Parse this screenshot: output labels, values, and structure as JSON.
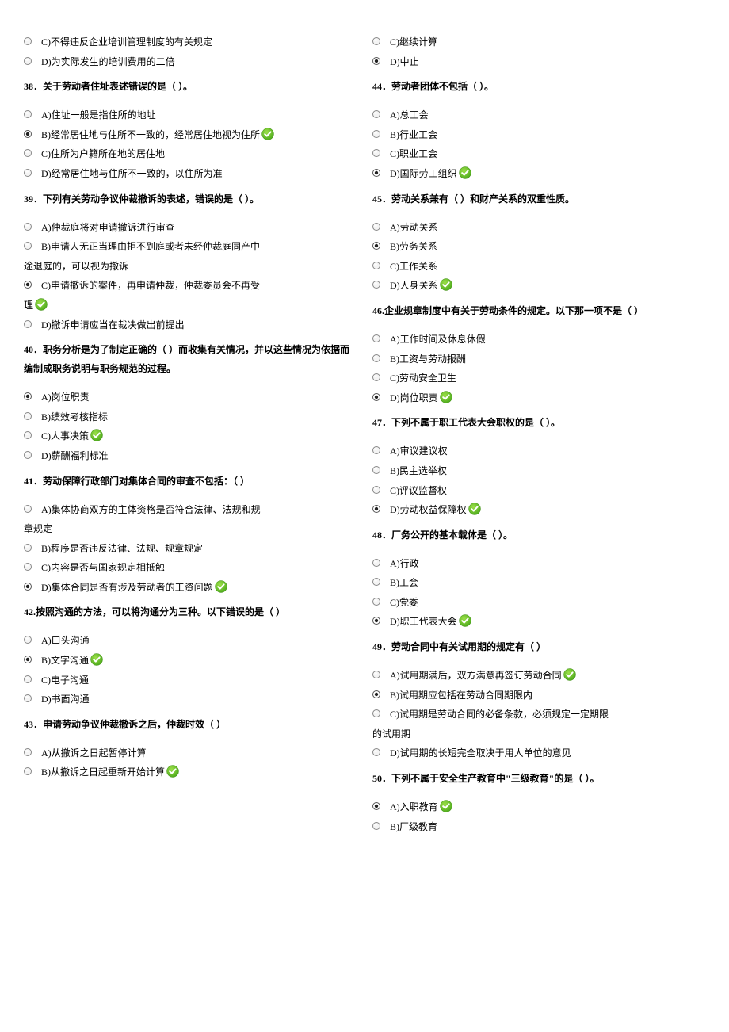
{
  "left": {
    "pre_options": [
      {
        "l": "C)",
        "t": "不得违反企业培训管理制度的有关规定",
        "sel": false,
        "ok": false
      },
      {
        "l": "D)",
        "t": "为实际发生的培训费用的二倍",
        "sel": false,
        "ok": false
      }
    ],
    "q38": {
      "title": "38．关于劳动者住址表述错误的是（  ）。",
      "opts": [
        {
          "l": "A)",
          "t": "住址一般是指住所的地址",
          "sel": false,
          "ok": false
        },
        {
          "l": "B)",
          "t": "经常居住地与住所不一致的，经常居住地视为住所",
          "sel": true,
          "ok": true
        },
        {
          "l": "C)",
          "t": "住所为户籍所在地的居住地",
          "sel": false,
          "ok": false
        },
        {
          "l": "D)",
          "t": "经常居住地与住所不一致的，以住所为准",
          "sel": false,
          "ok": false
        }
      ]
    },
    "q39": {
      "title": "39．下列有关劳动争议仲裁撤诉的表述，错误的是（  ）。",
      "opts": [
        {
          "l": "A)",
          "t": "仲裁庭将对申请撤诉进行审查",
          "sel": false,
          "ok": false
        },
        {
          "l": "B)",
          "t": "申请人无正当理由拒不到庭或者未经仲裁庭同产中",
          "cont": "途退庭的，可以视为撤诉",
          "sel": false,
          "ok": false
        },
        {
          "l": "C)",
          "t": "申请撤诉的案件，再申请仲裁，仲裁委员会不再受",
          "cont": "理",
          "sel": true,
          "ok": true
        },
        {
          "l": "D)",
          "t": "撤诉申请应当在裁决做出前提出",
          "sel": false,
          "ok": false
        }
      ]
    },
    "q40": {
      "title": "40．职务分析是为了制定正确的（  ）而收集有关情况，并以这些情况为依据而编制成职务说明与职务规范的过程。",
      "opts": [
        {
          "l": "A)",
          "t": "岗位职责",
          "sel": true,
          "ok": false
        },
        {
          "l": "B)",
          "t": "绩效考核指标",
          "sel": false,
          "ok": false
        },
        {
          "l": "C)",
          "t": "人事决策",
          "sel": false,
          "ok": true
        },
        {
          "l": "D)",
          "t": "薪酬福利标准",
          "sel": false,
          "ok": false
        }
      ]
    },
    "q41": {
      "title": "41．劳动保障行政部门对集体合同的审查不包括：（  ）",
      "opts": [
        {
          "l": "A)",
          "t": "集体协商双方的主体资格是否符合法律、法规和规",
          "cont": "章规定",
          "sel": false,
          "ok": false
        },
        {
          "l": "B)",
          "t": "程序是否违反法律、法规、规章规定",
          "sel": false,
          "ok": false
        },
        {
          "l": "C)",
          "t": "内容是否与国家规定相抵触",
          "sel": false,
          "ok": false
        },
        {
          "l": "D)",
          "t": "集体合同是否有涉及劳动者的工资问题",
          "sel": true,
          "ok": true
        }
      ]
    },
    "q42": {
      "title": "42.按照沟通的方法，可以将沟通分为三种。以下错误的是（ ）",
      "opts": [
        {
          "l": "A)",
          "t": "口头沟通",
          "sel": false,
          "ok": false
        },
        {
          "l": "B)",
          "t": "文字沟通",
          "sel": true,
          "ok": true
        },
        {
          "l": "C)",
          "t": "电子沟通",
          "sel": false,
          "ok": false
        },
        {
          "l": "D)",
          "t": "书面沟通",
          "sel": false,
          "ok": false
        }
      ]
    },
    "q43": {
      "title": "43．申请劳动争议仲裁撤诉之后，仲裁时效（  ）",
      "opts": [
        {
          "l": "A)",
          "t": "从撤诉之日起暂停计算",
          "sel": false,
          "ok": false
        },
        {
          "l": "B)",
          "t": "从撤诉之日起重新开始计算",
          "sel": false,
          "ok": true
        }
      ]
    }
  },
  "right": {
    "pre_options": [
      {
        "l": "C)",
        "t": "继续计算",
        "sel": false,
        "ok": false
      },
      {
        "l": "D)",
        "t": "中止",
        "sel": true,
        "ok": false
      }
    ],
    "q44": {
      "title": "44．劳动者团体不包括（  ）。",
      "opts": [
        {
          "l": "A)",
          "t": "总工会",
          "sel": false,
          "ok": false
        },
        {
          "l": "B)",
          "t": "行业工会",
          "sel": false,
          "ok": false
        },
        {
          "l": "C)",
          "t": "职业工会",
          "sel": false,
          "ok": false
        },
        {
          "l": "D)",
          "t": "国际劳工组织",
          "sel": true,
          "ok": true
        }
      ]
    },
    "q45": {
      "title": "45．劳动关系兼有（  ）和财产关系的双重性质。",
      "opts": [
        {
          "l": "A)",
          "t": "劳动关系",
          "sel": false,
          "ok": false
        },
        {
          "l": "B)",
          "t": "劳务关系",
          "sel": true,
          "ok": false
        },
        {
          "l": "C)",
          "t": "工作关系",
          "sel": false,
          "ok": false
        },
        {
          "l": "D)",
          "t": "人身关系",
          "sel": false,
          "ok": true
        }
      ]
    },
    "q46": {
      "title": "46.企业规章制度中有关于劳动条件的规定。以下那一项不是（ ）",
      "opts": [
        {
          "l": "A)",
          "t": "工作时间及休息休假",
          "sel": false,
          "ok": false
        },
        {
          "l": "B)",
          "t": "工资与劳动报酬",
          "sel": false,
          "ok": false
        },
        {
          "l": "C)",
          "t": "劳动安全卫生",
          "sel": false,
          "ok": false
        },
        {
          "l": "D)",
          "t": "岗位职责",
          "sel": true,
          "ok": true
        }
      ]
    },
    "q47": {
      "title": "47．下列不属于职工代表大会职权的是（  ）。",
      "opts": [
        {
          "l": "A)",
          "t": "审议建议权",
          "sel": false,
          "ok": false
        },
        {
          "l": "B)",
          "t": "民主选举权",
          "sel": false,
          "ok": false
        },
        {
          "l": "C)",
          "t": "评议监督权",
          "sel": false,
          "ok": false
        },
        {
          "l": "D)",
          "t": "劳动权益保障权",
          "sel": true,
          "ok": true
        }
      ]
    },
    "q48": {
      "title": "48．厂务公开的基本载体是（  ）。",
      "opts": [
        {
          "l": "A)",
          "t": "行政",
          "sel": false,
          "ok": false
        },
        {
          "l": "B)",
          "t": "工会",
          "sel": false,
          "ok": false
        },
        {
          "l": "C)",
          "t": "党委",
          "sel": false,
          "ok": false
        },
        {
          "l": "D)",
          "t": "职工代表大会",
          "sel": true,
          "ok": true
        }
      ]
    },
    "q49": {
      "title": "49．劳动合同中有关试用期的规定有（  ）",
      "opts": [
        {
          "l": "A)",
          "t": "试用期满后，双方满意再签订劳动合同",
          "sel": false,
          "ok": true
        },
        {
          "l": "B)",
          "t": "试用期应包括在劳动合同期限内",
          "sel": true,
          "ok": false
        },
        {
          "l": "C)",
          "t": "试用期是劳动合同的必备条款，必须规定一定期限",
          "cont": "的试用期",
          "sel": false,
          "ok": false
        },
        {
          "l": "D)",
          "t": "试用期的长短完全取决于用人单位的意见",
          "sel": false,
          "ok": false
        }
      ]
    },
    "q50": {
      "title": "50．下列不属于安全生产教育中\"三级教育\"的是（  ）。",
      "opts": [
        {
          "l": "A)",
          "t": "入职教育",
          "sel": true,
          "ok": true
        },
        {
          "l": "B)",
          "t": "厂级教育",
          "sel": false,
          "ok": false
        }
      ]
    }
  }
}
